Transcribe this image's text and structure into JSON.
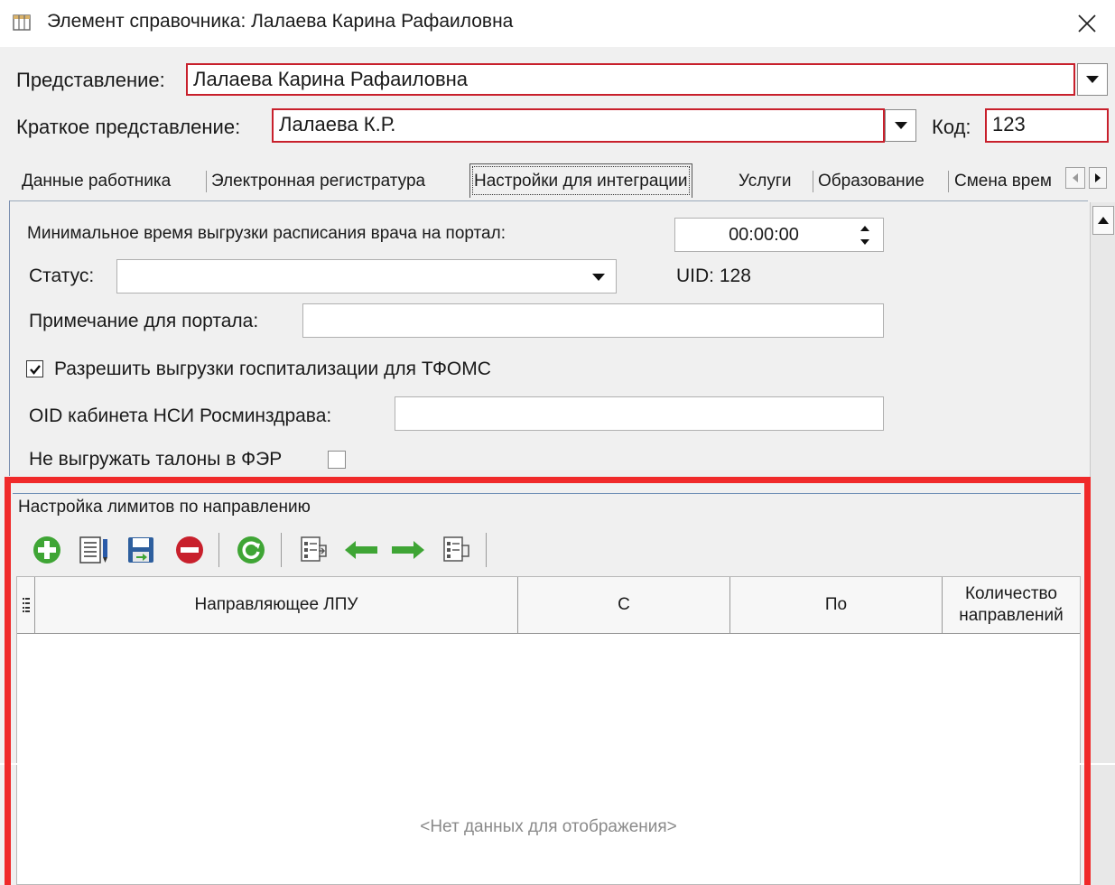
{
  "window": {
    "title": "Элемент справочника: Лалаева Карина Рафаиловна"
  },
  "header": {
    "representation_label": "Представление:",
    "representation_value": "Лалаева Карина Рафаиловна",
    "short_label": "Краткое представление:",
    "short_value": "Лалаева К.Р.",
    "code_label": "Код:",
    "code_value": "123"
  },
  "tabs": [
    {
      "label": "Данные работника"
    },
    {
      "label": "Электронная регистратура"
    },
    {
      "label": "Настройки для интеграции"
    },
    {
      "label": "Услуги"
    },
    {
      "label": "Образование"
    },
    {
      "label": "Смена врем"
    }
  ],
  "active_tab": "Настройки для интеграции",
  "integration": {
    "min_time_label": "Минимальное время выгрузки расписания врача на портал:",
    "min_time_value": "00:00:00",
    "status_label": "Статус:",
    "status_value": "",
    "uid_text": "UID: 128",
    "note_label": "Примечание для портала:",
    "note_value": "",
    "allow_upload_label": "Разрешить выгрузки госпитализации для ТФОМС",
    "allow_upload_checked": true,
    "oid_label": "OID кабинета НСИ Росминздрава:",
    "oid_value": "",
    "no_coupons_label": "Не выгружать талоны в ФЭР",
    "no_coupons_checked": false
  },
  "limits": {
    "group_title": "Настройка лимитов по направлению",
    "toolbar": [
      {
        "icon": "add-icon"
      },
      {
        "icon": "edit-icon"
      },
      {
        "icon": "save-icon"
      },
      {
        "icon": "delete-icon"
      },
      {
        "icon": "refresh-icon"
      },
      {
        "icon": "copy-icon"
      },
      {
        "icon": "arrow-left-icon"
      },
      {
        "icon": "arrow-right-icon"
      },
      {
        "icon": "paste-icon"
      }
    ],
    "columns": [
      "Направляющее ЛПУ",
      "С",
      "По",
      "Количество направлений"
    ],
    "rows": [],
    "empty_text": "<Нет данных для отображения>"
  },
  "colors": {
    "accent_red": "#f02a2a",
    "field_border_red": "#c8202c",
    "icon_green": "#3fa535",
    "icon_red": "#c8202c"
  }
}
